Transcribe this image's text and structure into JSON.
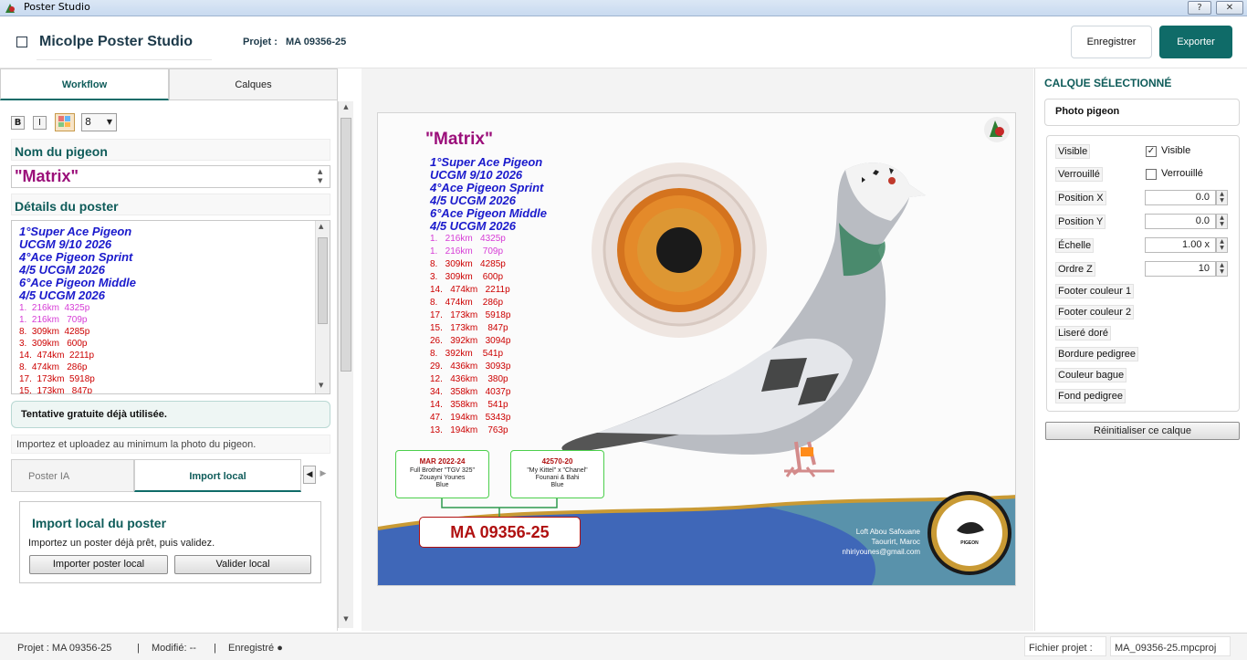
{
  "window": {
    "title": "Poster Studio",
    "help_btn": "?",
    "close_btn": "✕"
  },
  "header": {
    "app_name": "Micolpe Poster Studio",
    "project_label": "Projet :",
    "project_value": "MA 09356-25",
    "save_label": "Enregistrer",
    "export_label": "Exporter"
  },
  "left": {
    "tabs": [
      "Workflow",
      "Calques"
    ],
    "format": {
      "bold": "B",
      "italic": "I",
      "size": "8"
    },
    "name_title": "Nom du pigeon",
    "name_value": "\"Matrix\"",
    "details_title": "Détails du poster",
    "details_bold": [
      "1°Super Ace Pigeon",
      "UCGM 9/10 2026",
      "4°Ace Pigeon Sprint",
      "4/5 UCGM 2026",
      "6°Ace Pigeon Middle",
      "4/5 UCGM 2026"
    ],
    "details_pink": [
      "1.  216km  4325p",
      "1.  216km   709p"
    ],
    "details_red": [
      "8.  309km  4285p",
      "3.  309km   600p",
      "14.  474km  2211p",
      "8.  474km   286p",
      "17.  173km  5918p",
      "15.  173km   847p"
    ],
    "notice": "Tentative gratuite déjà utilisée.",
    "hint": "Importez et uploadez au minimum la photo du pigeon.",
    "subtabs": [
      "Poster IA",
      "Import local"
    ],
    "import_title": "Import local du poster",
    "import_desc": "Importez un poster déjà prêt, puis validez.",
    "import_btn": "Importer poster local",
    "validate_btn": "Valider local"
  },
  "poster": {
    "name": "\"Matrix\"",
    "titles": [
      "1°Super Ace Pigeon",
      "UCGM 9/10 2026",
      "4°Ace Pigeon Sprint",
      "4/5 UCGM 2026",
      "6°Ace Pigeon Middle",
      "4/5 UCGM 2026"
    ],
    "results_pink": [
      "1.   216km   4325p",
      "1.   216km    709p"
    ],
    "results_red": [
      "8.   309km   4285p",
      "3.   309km    600p",
      "14.   474km   2211p",
      "8.   474km    286p",
      "17.   173km   5918p",
      "15.   173km    847p",
      "26.   392km   3094p",
      "8.   392km    541p",
      "29.   436km   3093p",
      "12.   436km    380p",
      "34.   358km   4037p",
      "14.   358km    541p",
      "47.   194km   5343p",
      "13.   194km    763p"
    ],
    "parent1": {
      "ring": "MAR 2022-24",
      "line1": "Full Brother \"TGV 325\"",
      "line2": "Zouayni Younes",
      "line3": "Blue"
    },
    "parent2": {
      "ring": "42570-20",
      "line1": "\"My Kittel\" x \"Chanel\"",
      "line2": "Founani & Bahi",
      "line3": "Blue"
    },
    "ring": "MA 09356-25",
    "contact": [
      "Loft Abou Safouane",
      "Taourirt, Maroc",
      "nhiriyounes@gmail.com"
    ],
    "logo_text": "PIGEON"
  },
  "right": {
    "title": "CALQUE SÉLECTIONNÉ",
    "selected": "Photo pigeon",
    "visible_label": "Visible",
    "visible_check": "Visible",
    "locked_label": "Verrouillé",
    "locked_check": "Verrouillé",
    "posx_label": "Position X",
    "posx_value": "0.0",
    "posy_label": "Position Y",
    "posy_value": "0.0",
    "scale_label": "Échelle",
    "scale_value": "1.00 x",
    "z_label": "Ordre Z",
    "z_value": "10",
    "buttons": [
      "Footer couleur 1",
      "Footer couleur 2",
      "Liseré doré",
      "Bordure pedigree",
      "Couleur bague",
      "Fond pedigree"
    ],
    "reset": "Réinitialiser ce calque"
  },
  "status": {
    "project": "Projet : MA 09356-25",
    "modified": "Modifié: --",
    "saved": "Enregistré ●",
    "file_label": "Fichier projet :",
    "file_value": "MA_09356-25.mpcproj"
  },
  "colors": {
    "accent": "#0f6b68",
    "name": "#9b0f7a",
    "titles": "#1a1acc",
    "results": "#cc0000",
    "pink": "#d63cd6",
    "footer_blue": "#3f67b8"
  }
}
